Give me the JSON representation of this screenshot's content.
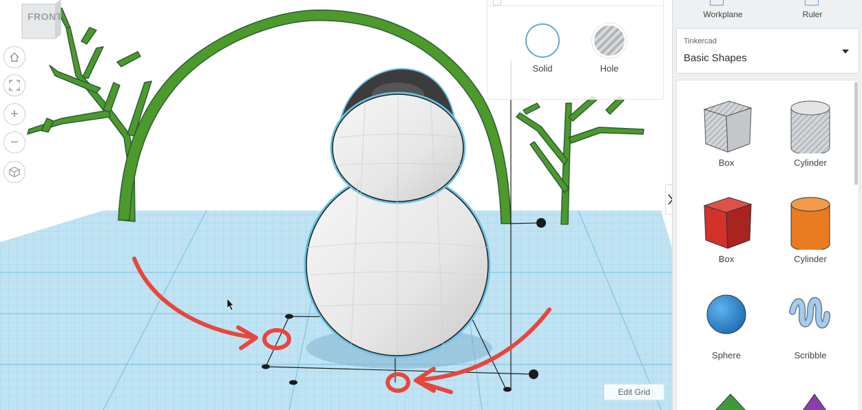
{
  "viewcube": {
    "face_label": "FRONT"
  },
  "nav_controls": [
    {
      "name": "home",
      "icon": "home-icon"
    },
    {
      "name": "fit",
      "icon": "fit-to-view-icon"
    },
    {
      "name": "zoom-in",
      "icon": "plus-icon",
      "glyph": "+"
    },
    {
      "name": "zoom-out",
      "icon": "minus-icon",
      "glyph": "−"
    },
    {
      "name": "perspective",
      "icon": "perspective-cube-icon"
    }
  ],
  "shape_mode": {
    "solid_label": "Solid",
    "hole_label": "Hole",
    "solid_color": "#6aa4d8"
  },
  "grid": {
    "edit_label": "Edit Grid"
  },
  "sidebar": {
    "tools": [
      {
        "label": "Workplane",
        "icon": "workplane-icon"
      },
      {
        "label": "Ruler",
        "icon": "ruler-icon"
      }
    ],
    "library": {
      "brand": "Tinkercad",
      "selected": "Basic Shapes"
    },
    "shapes": [
      {
        "label": "Box",
        "icon": "box-hole-icon",
        "color": "#c8ccd0"
      },
      {
        "label": "Cylinder",
        "icon": "cylinder-hole-icon",
        "color": "#c8ccd0"
      },
      {
        "label": "Box",
        "icon": "box-icon",
        "color": "#d4312b"
      },
      {
        "label": "Cylinder",
        "icon": "cylinder-icon",
        "color": "#e97b21"
      },
      {
        "label": "Sphere",
        "icon": "sphere-icon",
        "color": "#2a8ad8"
      },
      {
        "label": "Scribble",
        "icon": "scribble-icon",
        "color": "#9cc0e0"
      }
    ]
  },
  "colors": {
    "grid_blue": "#b8def0",
    "branch_green": "#4c9a2a",
    "annotation_red": "#e8463c",
    "snowman_white": "#ececec"
  }
}
